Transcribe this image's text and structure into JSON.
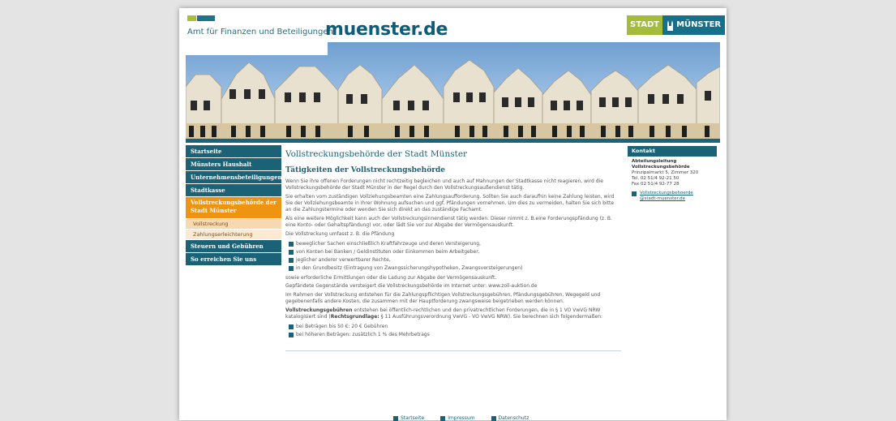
{
  "header": {
    "department": "Amt für Finanzen und Beteiligungen",
    "site_name": "muenster.de",
    "city_logo_left": "STADT",
    "city_logo_right": "MÜNSTER"
  },
  "nav": {
    "items": [
      {
        "label": "Startseite"
      },
      {
        "label": "Münsters Haushalt"
      },
      {
        "label": "Unternehmensbeteiligungen"
      },
      {
        "label": "Stadtkasse"
      },
      {
        "label": "Vollstreckungsbehörde der Stadt Münster"
      },
      {
        "label": "Vollstreckung"
      },
      {
        "label": "Zahlungserleichterung"
      },
      {
        "label": "Steuern und Gebühren"
      },
      {
        "label": "So erreichen Sie uns"
      }
    ]
  },
  "main": {
    "title": "Vollstreckungsbehörde der Stadt Münster",
    "subtitle": "Tätigkeiten der Vollstreckungsbehörde",
    "p1": "Wenn Sie ihre offenen Forderungen nicht rechtzeitig begleichen und auch auf Mahnungen der Stadtkasse nicht reagieren, wird die Vollstreckungsbehörde der Stadt Münster in der Regel durch den Vollstreckungsaußendienst tätig.",
    "p2": "Sie erhalten vom zuständigen Vollziehungsbeamten eine Zahlungsaufforderung. Sollten Sie auch daraufhin keine Zahlung leisten, wird Sie der Vollziehungsbeamte in Ihrer Wohnung aufsuchen und ggf. Pfändungen vornehmen. Um dies zu vermeiden, halten Sie sich bitte an die Zahlungstermine oder wenden Sie sich direkt an das zuständige Fachamt.",
    "p3": "Als eine weitere Möglichkeit kann auch der Vollstreckungsinnendienst tätig werden. Dieser nimmt z. B.eine Forderungspfändung (z. B. eine Konto- oder Gehaltspfändung) vor, oder lädt Sie vor zur Abgabe der Vermögensauskunft.",
    "p4": "Die Vollstreckung umfasst z. B. die Pfändung",
    "list1": [
      "beweglicher Sachen einschließlich Kraftfahrzeuge und deren Versteigerung,",
      "von Konten bei Banken / Geldinstituten oder Einkommen beim Arbeitgeber,",
      "jeglicher anderer verwertbarer Rechte,",
      "in den Grundbesitz (Eintragung von Zwangssicherungshypotheken, Zwangsversteigerungen)"
    ],
    "p5": "sowie erforderliche Ermittlungen oder die Ladung zur Abgabe der Vermögensauskunft.",
    "p6": "Gepfändete Gegenstände versteigert die Vollstreckungsbehörde im Internet unter: www.zoll-auktion.de",
    "p7": "Im Rahmen der Vollstreckung entstehen für die Zahlungspflichtigen Vollstreckungsgebühren, Pfändungsgebühren, Wegegeld und gegebenenfalls andere Kosten, die zusammen mit der Hauptforderung zwangsweise beigetrieben werden können.",
    "p8_bold": "Vollstreckungsgebühren",
    "p8_a": " entstehen bei öffentlich-rechtlichen und den privatrechtlichen Forderungen, die in § 1 VO VwVG NRW katalogisiert sind (",
    "p8_bold2": "Rechtsgrundlage:",
    "p8_b": " § 11 Ausführungsverordnung VwVG - VO VwVG NRW). Sie berechnen sich folgendermaßen:",
    "list2": [
      "bei Beträgen bis 50 €: 20 € Gebühren",
      "bei höheren Beträgen: zusätzlich 1 % des Mehrbetrags"
    ]
  },
  "footer": {
    "links": [
      "Startseite",
      "Impressum",
      "Datenschutz"
    ]
  },
  "contact": {
    "head": "Kontakt",
    "line1": "Abteilungsleitung",
    "line2": "Vollstreckungsbehörde",
    "line3": "Prinzipalmarkt 5, Zimmer 320",
    "line4": "Tel. 02 51/4 92-21 50",
    "line5": "Fax 02 51/4 92-77 28",
    "email_1": "Vollstreckungsbehoerde",
    "email_2": "@stadt-muenster.de"
  },
  "colors": {
    "teal": "#1c6276",
    "active_orange": "#ef9410",
    "logo_green": "#a4bc39"
  }
}
